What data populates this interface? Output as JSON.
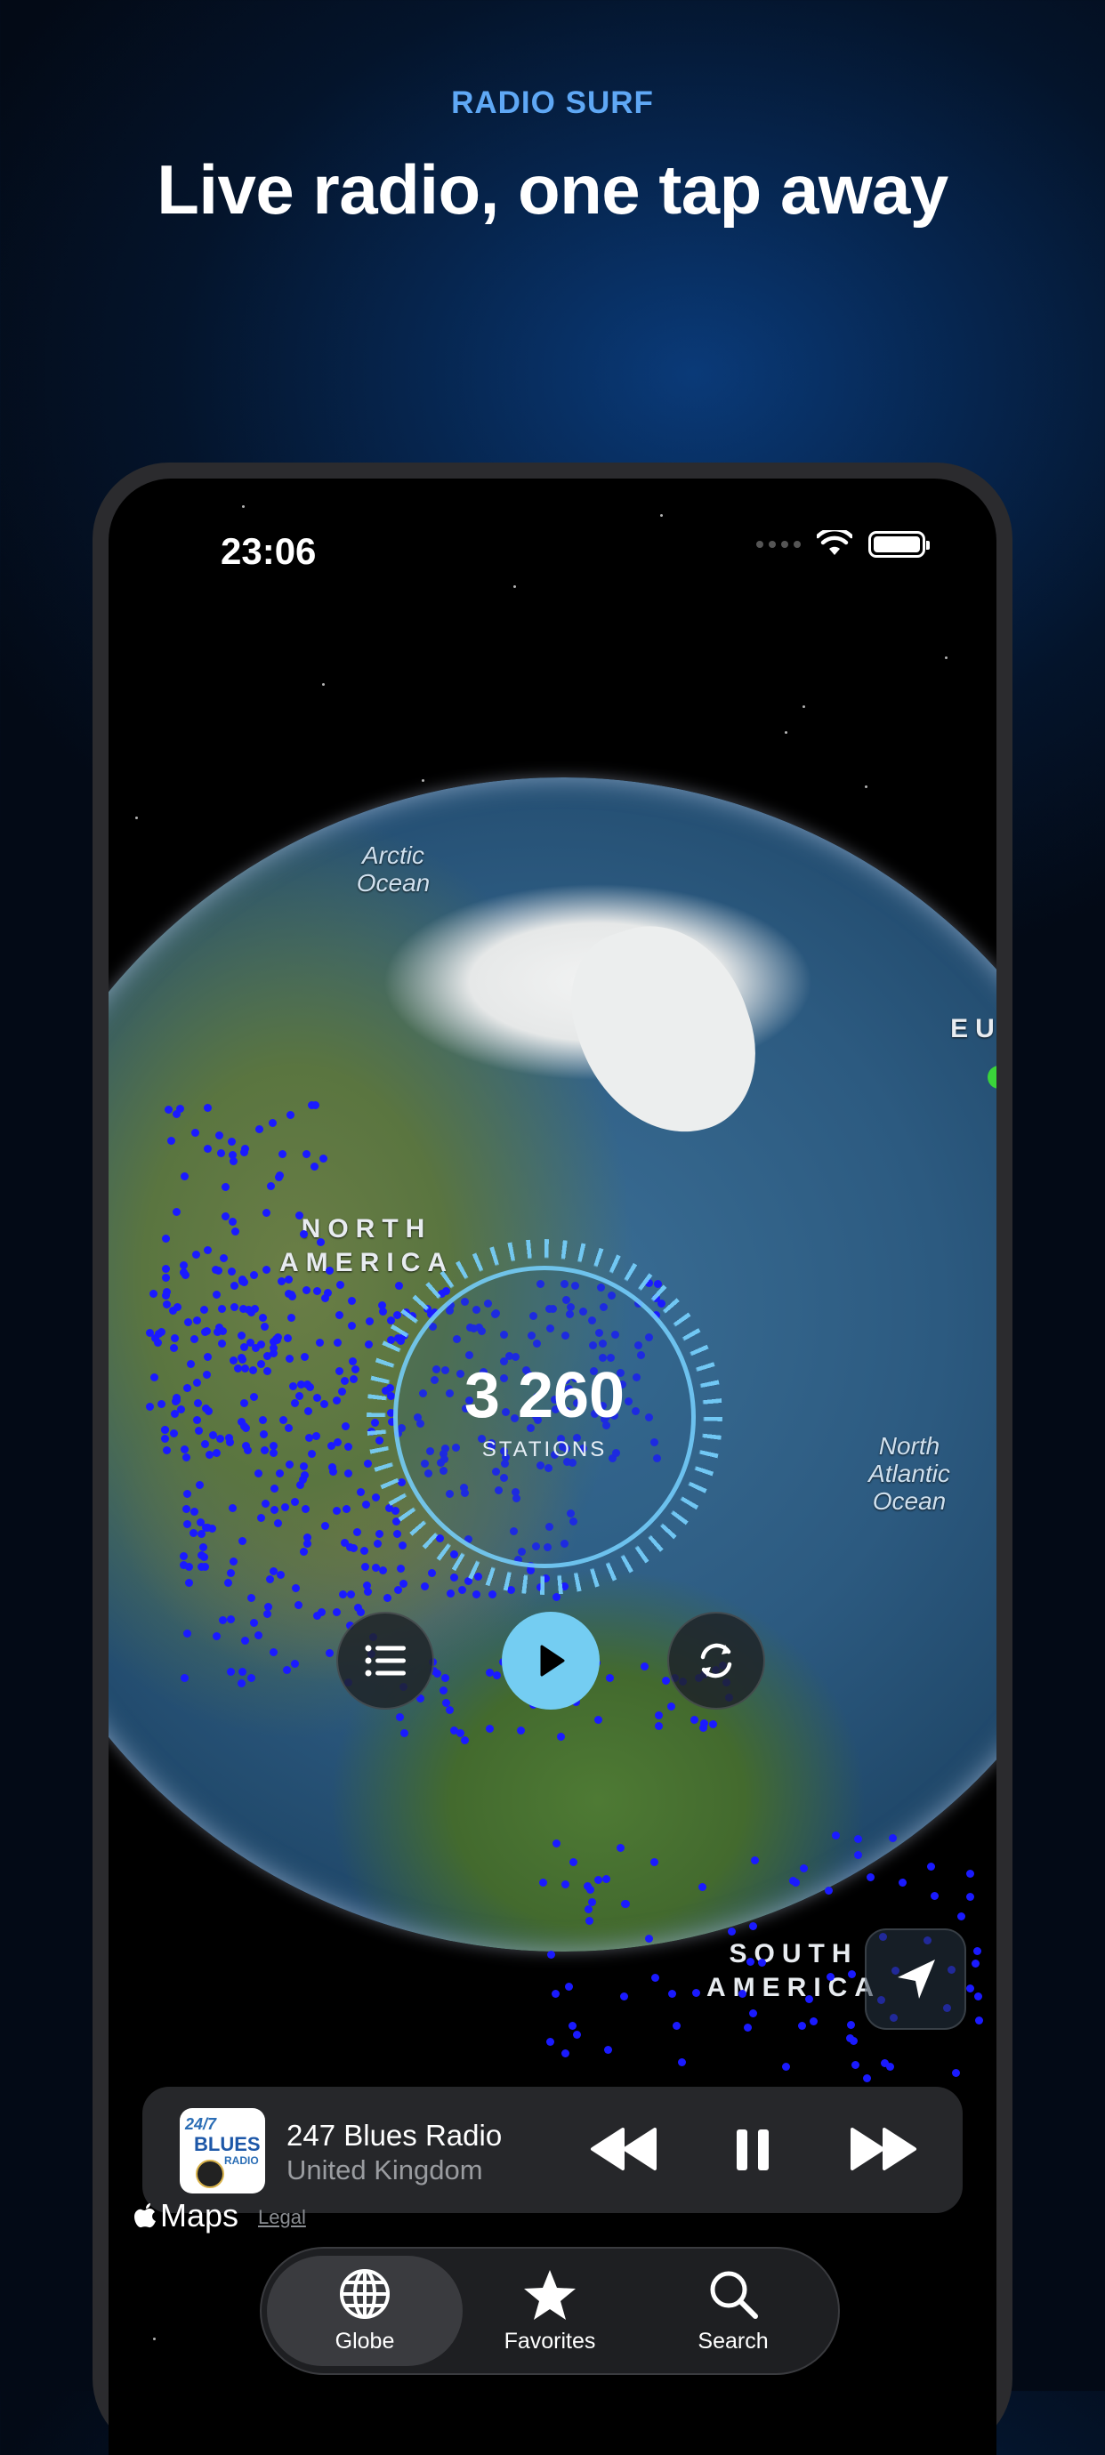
{
  "promo": {
    "brand": "RADIO SURF",
    "headline": "Live radio, one tap away"
  },
  "status_bar": {
    "time": "23:06"
  },
  "map": {
    "labels": {
      "arctic_ocean": [
        "Arctic",
        "Ocean"
      ],
      "north_america": [
        "NORTH",
        "AMERICA"
      ],
      "south_america": [
        "SOUTH",
        "AMERICA"
      ],
      "north_atlantic": [
        "North",
        "Atlantic",
        "Ocean"
      ],
      "europe_partial": "EU"
    },
    "attribution": {
      "brand": "Maps",
      "legal": "Legal"
    }
  },
  "stations_counter": {
    "count": "3 260",
    "label": "STATIONS"
  },
  "controls": {
    "list_icon": "list-icon",
    "play_icon": "play-icon",
    "shuffle_icon": "refresh-icon",
    "locate_icon": "location-arrow-icon"
  },
  "now_playing": {
    "artwork_text": [
      "24/7",
      "BLUES",
      "RADIO"
    ],
    "station": "247 Blues Radio",
    "country": "United Kingdom"
  },
  "tab_bar": {
    "tabs": [
      {
        "label": "Globe",
        "icon": "globe-icon",
        "active": true
      },
      {
        "label": "Favorites",
        "icon": "star-icon",
        "active": false
      },
      {
        "label": "Search",
        "icon": "search-icon",
        "active": false
      }
    ]
  },
  "colors": {
    "brand_accent": "#5fa8f5",
    "play_button": "#74cdf2",
    "station_dots": "#1a1aff"
  }
}
